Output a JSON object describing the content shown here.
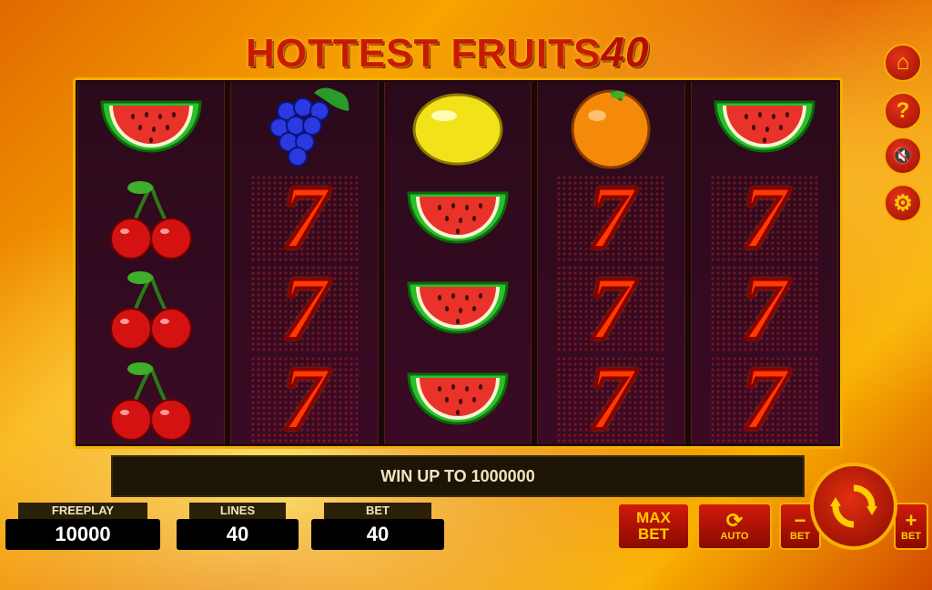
{
  "title": {
    "main": "HOTTEST FRUITS",
    "number": "40"
  },
  "side_buttons": [
    {
      "icon": "home-icon",
      "glyph": "⌂"
    },
    {
      "icon": "help-icon",
      "glyph": "?"
    },
    {
      "icon": "sound-muted-icon",
      "glyph": "🔇"
    },
    {
      "icon": "settings-icon",
      "glyph": "⚙"
    }
  ],
  "reels": [
    [
      "watermelon",
      "cherries",
      "cherries",
      "cherries"
    ],
    [
      "grapes",
      "seven",
      "seven",
      "seven"
    ],
    [
      "lemon",
      "watermelon",
      "watermelon",
      "watermelon"
    ],
    [
      "orange",
      "seven",
      "seven",
      "seven"
    ],
    [
      "watermelon",
      "seven",
      "seven",
      "seven"
    ]
  ],
  "seven_glyph": "7",
  "win_message": "WIN UP TO 1000000",
  "freeplay": {
    "label": "FREEPLAY",
    "value": "10000"
  },
  "lines": {
    "label": "LINES",
    "value": "40"
  },
  "bet": {
    "label": "BET",
    "value": "40"
  },
  "buttons": {
    "max_bet_line1": "MAX",
    "max_bet_line2": "BET",
    "auto": "AUTO",
    "bet_minus_sign": "−",
    "bet_minus_label": "BET",
    "bet_plus_sign": "+",
    "bet_plus_label": "BET"
  },
  "colors": {
    "accent": "#f7b000",
    "button_red": "#c81a0a"
  }
}
